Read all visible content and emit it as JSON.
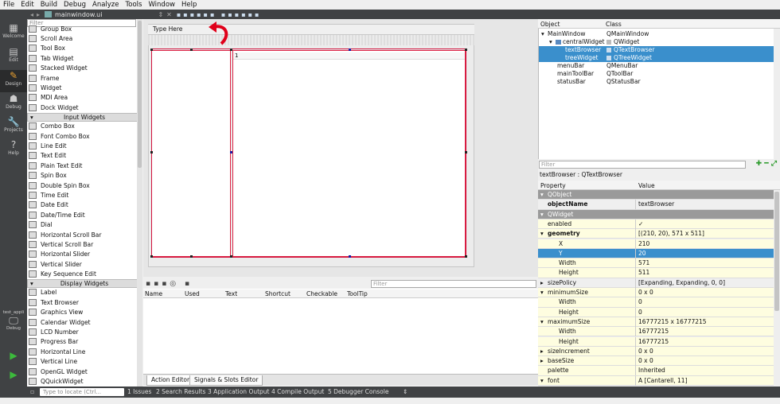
{
  "menu": [
    "File",
    "Edit",
    "Build",
    "Debug",
    "Analyze",
    "Tools",
    "Window",
    "Help"
  ],
  "modes": [
    "Welcome",
    "Edit",
    "Design",
    "Debug",
    "Projects",
    "Help"
  ],
  "kit": {
    "project": "test_appli",
    "mode": "Debug"
  },
  "doc": {
    "filename": "mainwindow.ui"
  },
  "widgetbox": {
    "filter_placeholder": "Filter",
    "items_top": [
      "Group Box",
      "Scroll Area",
      "Tool Box",
      "Tab Widget",
      "Stacked Widget",
      "Frame",
      "Widget",
      "MDI Area",
      "Dock Widget"
    ],
    "cat_input": "Input Widgets",
    "items_input": [
      "Combo Box",
      "Font Combo Box",
      "Line Edit",
      "Text Edit",
      "Plain Text Edit",
      "Spin Box",
      "Double Spin Box",
      "Time Edit",
      "Date Edit",
      "Date/Time Edit",
      "Dial",
      "Horizontal Scroll Bar",
      "Vertical Scroll Bar",
      "Horizontal Slider",
      "Vertical Slider",
      "Key Sequence Edit"
    ],
    "cat_display": "Display Widgets",
    "items_display": [
      "Label",
      "Text Browser",
      "Graphics View",
      "Calendar Widget",
      "LCD Number",
      "Progress Bar",
      "Horizontal Line",
      "Vertical Line",
      "OpenGL Widget",
      "QQuickWidget"
    ]
  },
  "form": {
    "menu_placeholder": "Type Here",
    "tree_first_item": "1"
  },
  "action_editor": {
    "filter_placeholder": "Filter",
    "columns": [
      "Name",
      "Used",
      "Text",
      "Shortcut",
      "Checkable",
      "ToolTip"
    ],
    "tabs": [
      "Action Editor",
      "Signals & Slots Editor"
    ]
  },
  "object_inspector": {
    "columns": [
      "Object",
      "Class"
    ],
    "rows": [
      {
        "object": "MainWindow",
        "class": "QMainWindow",
        "indent": 0,
        "sel": false,
        "arrow": "▾"
      },
      {
        "object": "centralWidget",
        "class": "QWidget",
        "indent": 1,
        "sel": false,
        "arrow": "▾"
      },
      {
        "object": "textBrowser",
        "class": "QTextBrowser",
        "indent": 2,
        "sel": true,
        "arrow": ""
      },
      {
        "object": "treeWidget",
        "class": "QTreeWidget",
        "indent": 2,
        "sel": true,
        "arrow": ""
      },
      {
        "object": "menuBar",
        "class": "QMenuBar",
        "indent": 1,
        "sel": false,
        "arrow": ""
      },
      {
        "object": "mainToolBar",
        "class": "QToolBar",
        "indent": 1,
        "sel": false,
        "arrow": ""
      },
      {
        "object": "statusBar",
        "class": "QStatusBar",
        "indent": 1,
        "sel": false,
        "arrow": ""
      }
    ]
  },
  "property_editor": {
    "filter_placeholder": "Filter",
    "context": "textBrowser : QTextBrowser",
    "columns": [
      "Property",
      "Value"
    ],
    "rows": [
      {
        "name": "QObject",
        "value": "",
        "type": "group"
      },
      {
        "name": "objectName",
        "value": "textBrowser",
        "type": "bold"
      },
      {
        "name": "QWidget",
        "value": "",
        "type": "group"
      },
      {
        "name": "enabled",
        "value": "✓",
        "type": "yellow"
      },
      {
        "name": "geometry",
        "value": "[(210, 20), 571 x 511]",
        "type": "yellow-bold-exp"
      },
      {
        "name": "X",
        "value": "210",
        "type": "yellow-sub"
      },
      {
        "name": "Y",
        "value": "20",
        "type": "sel-sub"
      },
      {
        "name": "Width",
        "value": "571",
        "type": "yellow-sub"
      },
      {
        "name": "Height",
        "value": "511",
        "type": "yellow-sub"
      },
      {
        "name": "sizePolicy",
        "value": "[Expanding, Expanding, 0, 0]",
        "type": "white-col"
      },
      {
        "name": "minimumSize",
        "value": "0 x 0",
        "type": "yellow-exp"
      },
      {
        "name": "Width",
        "value": "0",
        "type": "yellow-sub"
      },
      {
        "name": "Height",
        "value": "0",
        "type": "yellow-sub"
      },
      {
        "name": "maximumSize",
        "value": "16777215 x 16777215",
        "type": "yellow-exp"
      },
      {
        "name": "Width",
        "value": "16777215",
        "type": "yellow-sub"
      },
      {
        "name": "Height",
        "value": "16777215",
        "type": "yellow-sub"
      },
      {
        "name": "sizeIncrement",
        "value": "0 x 0",
        "type": "yellow-col"
      },
      {
        "name": "baseSize",
        "value": "0 x 0",
        "type": "yellow-col"
      },
      {
        "name": "palette",
        "value": "Inherited",
        "type": "yellow"
      },
      {
        "name": "font",
        "value": "A  [Cantarell, 11]",
        "type": "yellow-exp"
      }
    ]
  },
  "statusbar": {
    "locator_placeholder": "Type to locate (Ctrl...",
    "panes": [
      "1 Issues",
      "2 Search Results",
      "3 Application Output",
      "4 Compile Output",
      "5 Debugger Console"
    ]
  },
  "colors": {
    "selection": "#3a8fcc",
    "form_border": "#d0103a",
    "annotation_arrow": "#e0001a"
  }
}
